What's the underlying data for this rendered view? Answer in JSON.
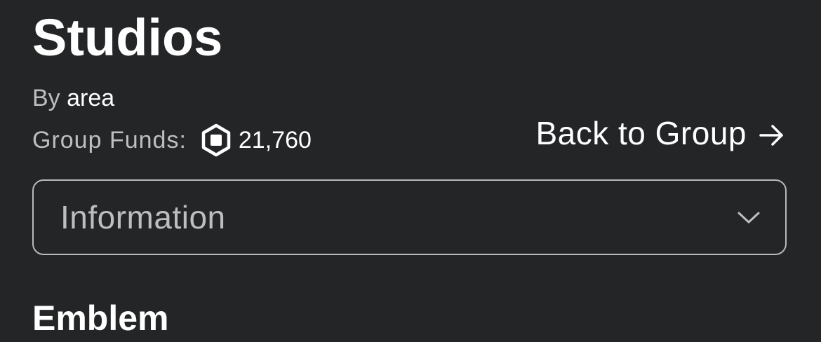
{
  "group": {
    "name": "Studios",
    "owner_prefix": "By",
    "owner_name": "area",
    "funds_label": "Group Funds:",
    "funds_value": "21,760",
    "currency_icon": "robux-icon"
  },
  "back_link": {
    "label": "Back to Group",
    "icon": "arrow-right-icon"
  },
  "section_select": {
    "selected": "Information",
    "icon": "chevron-down-icon"
  },
  "section": {
    "heading": "Emblem"
  },
  "colors": {
    "background": "#232527",
    "text_primary": "#ffffff",
    "text_secondary": "#bdbebe",
    "border": "#b8b9ba"
  }
}
